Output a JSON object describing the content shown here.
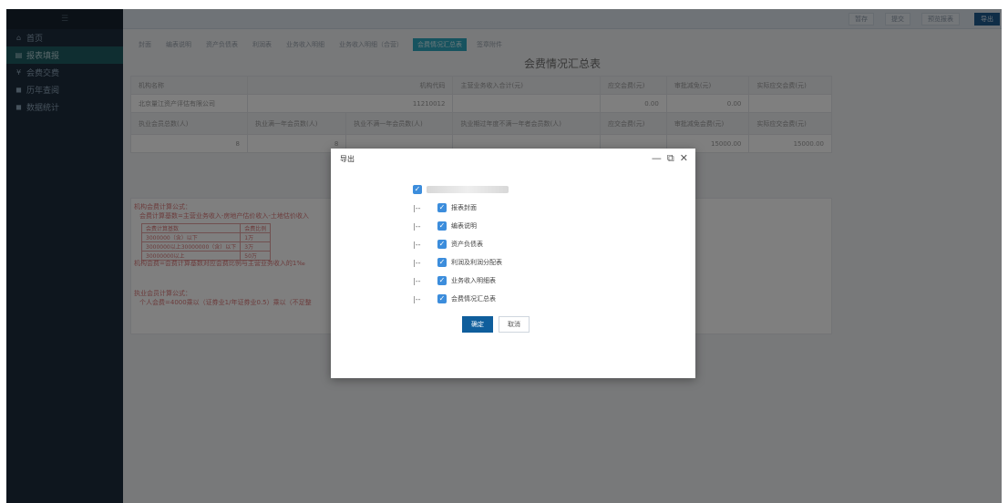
{
  "sidebar": {
    "top_icon": "menu-icon",
    "items": [
      {
        "icon": "home-icon",
        "glyph": "⌂",
        "label": "首页"
      },
      {
        "icon": "report-icon",
        "glyph": "▤",
        "label": "报表填报"
      },
      {
        "icon": "fee-icon",
        "glyph": "¥",
        "label": "会费交费"
      },
      {
        "icon": "history-icon",
        "glyph": "◼",
        "label": "历年查阅"
      },
      {
        "icon": "stats-icon",
        "glyph": "◼",
        "label": "数据统计"
      }
    ]
  },
  "topbar": {
    "buttons": [
      "暂存",
      "提交",
      "预览报表",
      "导出"
    ]
  },
  "tabs": [
    "封面",
    "编表说明",
    "资产负债表",
    "利润表",
    "业务收入明细",
    "业务收入明细（合营）",
    "会费情况汇总表",
    "签章附件"
  ],
  "active_tab_index": 6,
  "form": {
    "title": "会费情况汇总表",
    "row1_headers": [
      "机构名称",
      "机构代码",
      "主营业务收入合计(元)",
      "应交会费(元)",
      "审批减免(元)",
      "实际应交会费(元)"
    ],
    "row1_values": [
      "北京量江资产评估有限公司",
      "11210012",
      "",
      "0.00",
      "0.00",
      ""
    ],
    "row2_headers": [
      "执业会员总数(人)",
      "执业满一年会员数(人)",
      "执业不满一年会员数(人)",
      "执业期过年度不满一年者会员数(人)",
      "应交会费(元)",
      "审批减免会费(元)",
      "实际应交会费(元)"
    ],
    "row2_values": [
      "8",
      "8",
      "",
      "",
      "",
      "15000.00",
      "15000.00"
    ]
  },
  "rules": {
    "org_title": "机构会费计算公式：",
    "org_formula": "会费计算基数=主营业务收入-房地产估价收入-土地估价收入",
    "table": [
      [
        "会费计算基数",
        "会费比例"
      ],
      [
        "3000000（含）以下",
        "1万"
      ],
      [
        "3000000以上30000000（含）以下",
        "3万"
      ],
      [
        "30000000以上",
        "50万"
      ]
    ],
    "org_note": "机构会费=会费计算基数对应会费比例与主营业务收入的1‰",
    "person_title": "执业会员计算公式：",
    "person_formula": "个人会费=4000乘以（证券业1/年证券业0.5）乘以（不足整"
  },
  "modal": {
    "title": "导出",
    "controls": [
      "—",
      "⧉",
      "✕"
    ],
    "root_checked": true,
    "items": [
      "报表封面",
      "编表说明",
      "资产负债表",
      "利润及利润分配表",
      "业务收入明细表",
      "会费情况汇总表"
    ],
    "tree_connector": "|-- ",
    "confirm_label": "确定",
    "cancel_label": "取消"
  },
  "colors": {
    "sidebar_bg": "#1c2c3c",
    "sidebar_active": "#1f5d62",
    "tab_active": "#2ea6bf",
    "primary_btn": "#0f5e9c",
    "checkbox": "#3c8ddc",
    "rule_text": "#d87878"
  }
}
